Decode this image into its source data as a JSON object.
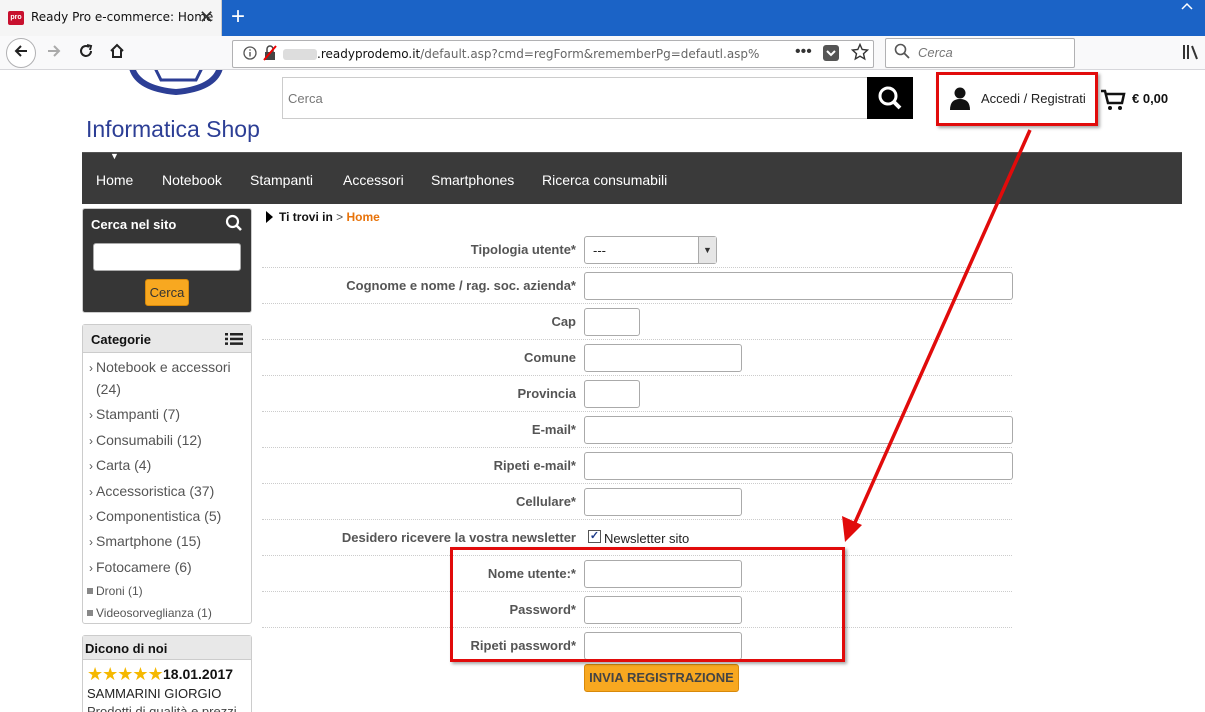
{
  "browser": {
    "tab_title": "Ready Pro e-commerce: Home",
    "favicon_text": "pro",
    "new_tab": "+",
    "close_tab": "✕",
    "url_domain": ".readyprodemo.it",
    "url_path": "/default.asp?cmd=regForm&rememberPg=defautl.asp%",
    "url_more": "•••",
    "search_placeholder": "Cerca"
  },
  "header": {
    "logo_text": "Informatica Shop",
    "search_placeholder": "Cerca",
    "account_label": "Accedi / Registrati",
    "cart_total": "€ 0,00"
  },
  "nav": {
    "items": [
      "Home",
      "Notebook",
      "Stampanti",
      "Accessori",
      "Smartphones",
      "Ricerca consumabili"
    ]
  },
  "sidebar": {
    "search_title": "Cerca nel sito",
    "search_button": "Cerca",
    "categories_title": "Categorie",
    "categories": [
      {
        "label": "Notebook e accessori",
        "count": "(24)"
      },
      {
        "label": "Stampanti (7)"
      },
      {
        "label": "Consumabili (12)"
      },
      {
        "label": "Carta (4)"
      },
      {
        "label": "Accessoristica (37)"
      },
      {
        "label": "Componentistica (5)"
      },
      {
        "label": "Smartphone (15)"
      },
      {
        "label": "Fotocamere (6)"
      }
    ],
    "subcategories": [
      "Droni (1)",
      "Videosorveglianza (1)"
    ],
    "reviews_title": "Dicono di noi",
    "review_stars": "★★★★★",
    "review_date": "18.01.2017",
    "review_author": "SAMMARINI GIORGIO",
    "review_text": "Prodotti di qualità e prezzi"
  },
  "breadcrumb": {
    "label": "Ti trovi in",
    "sep": ">",
    "current": "Home"
  },
  "form": {
    "fields": [
      {
        "label": "Tipologia utente*"
      },
      {
        "label": "Cognome e nome / rag. soc. azienda*"
      },
      {
        "label": "Cap"
      },
      {
        "label": "Comune"
      },
      {
        "label": "Provincia"
      },
      {
        "label": "E-mail*"
      },
      {
        "label": "Ripeti e-mail*"
      },
      {
        "label": "Cellulare*"
      },
      {
        "label": "Desidero ricevere la vostra newsletter"
      },
      {
        "label": "Nome utente:*"
      },
      {
        "label": "Password*"
      },
      {
        "label": "Ripeti password*"
      }
    ],
    "user_type_value": "---",
    "newsletter_option": "Newsletter sito",
    "newsletter_checked": true,
    "submit_label": "INVIA REGISTRAZIONE"
  },
  "colors": {
    "annotation": "#e10b0b",
    "accent_orange": "#f8a820",
    "nav_bg": "#3a3a3a",
    "browser_blue": "#1b63c6"
  }
}
